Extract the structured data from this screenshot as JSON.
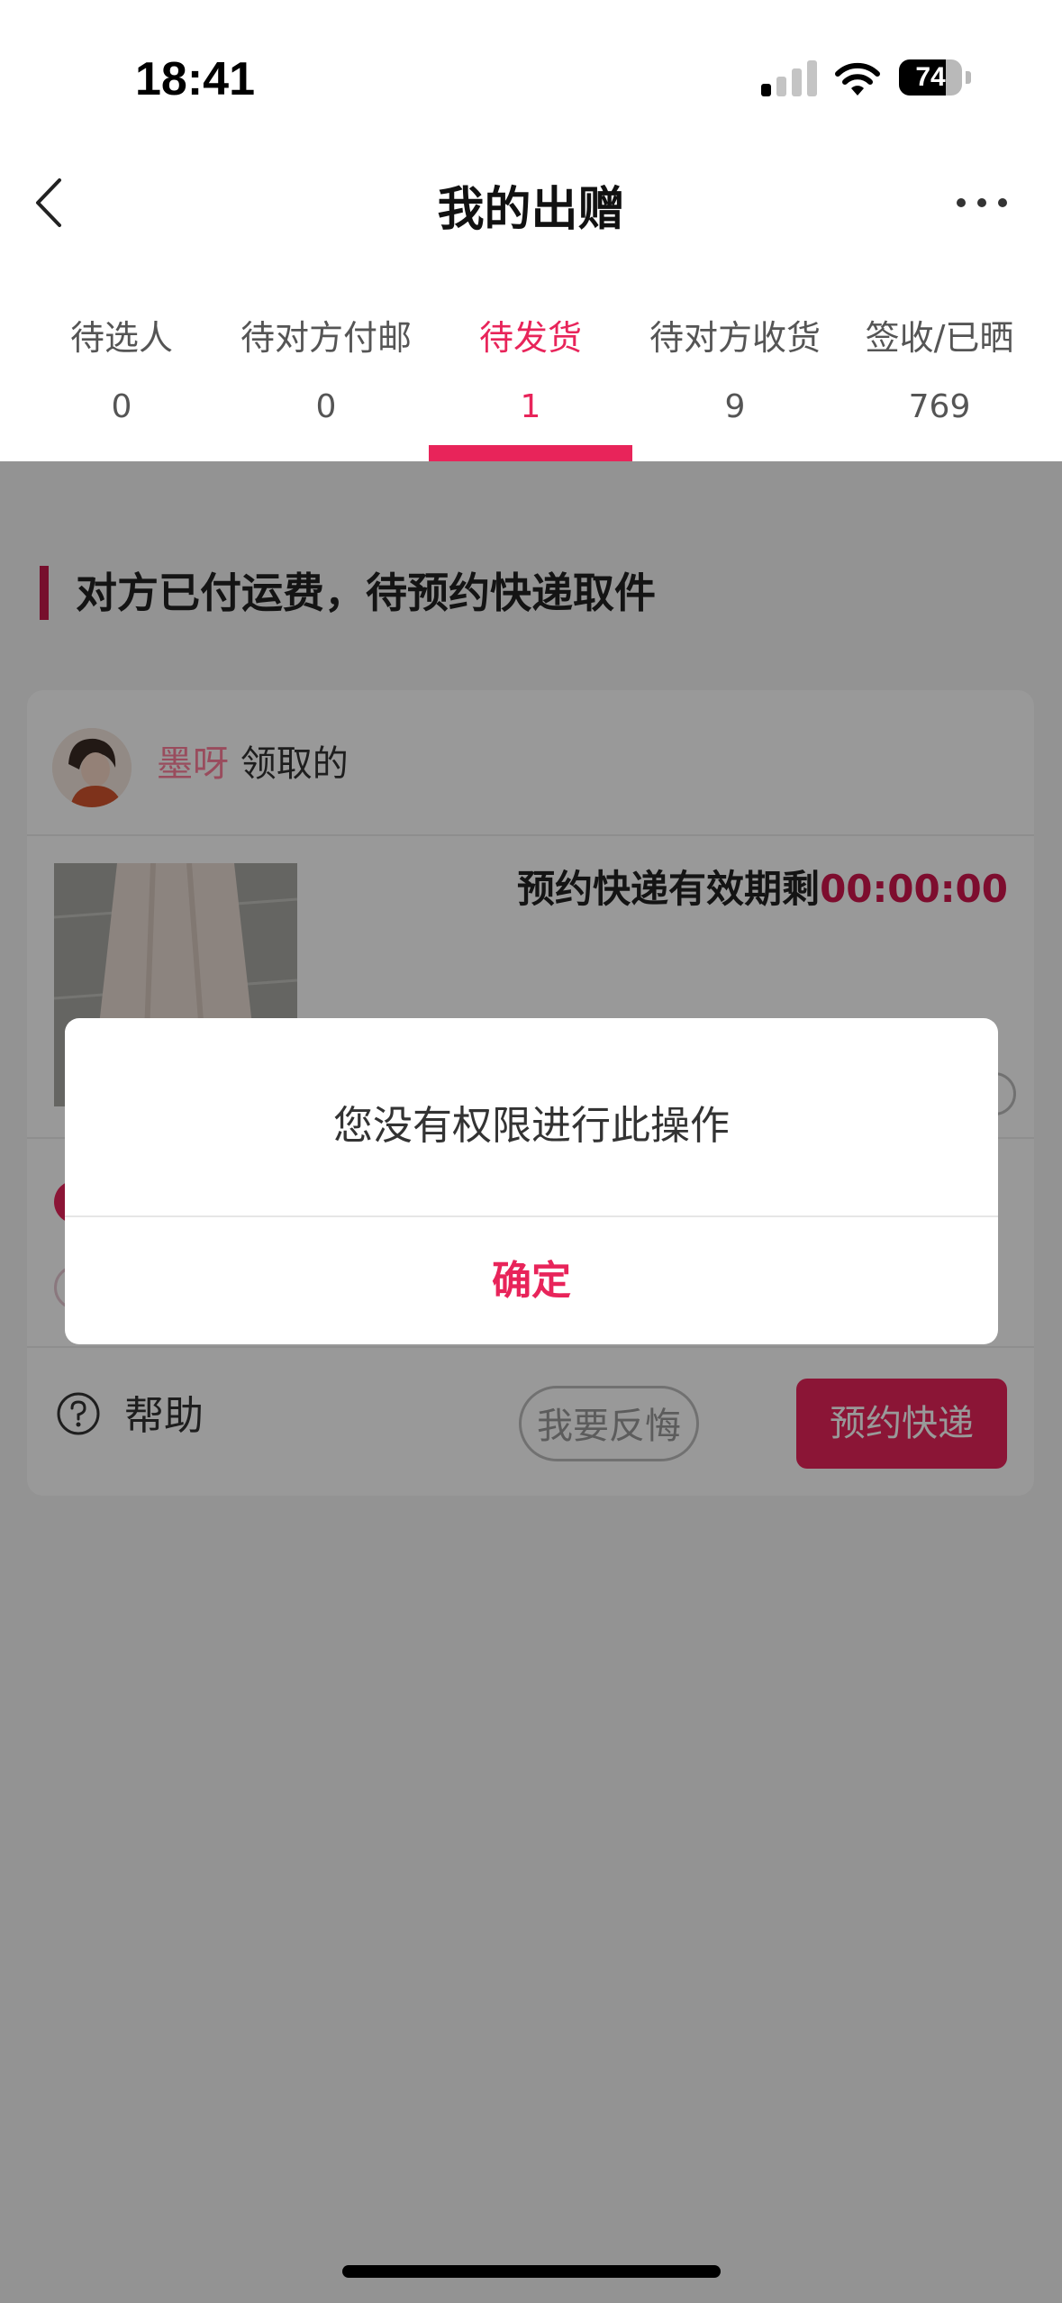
{
  "status_bar": {
    "time": "18:41",
    "battery": "74"
  },
  "nav": {
    "title": "我的出赠"
  },
  "tabs": [
    {
      "label": "待选人",
      "count": "0"
    },
    {
      "label": "待对方付邮",
      "count": "0"
    },
    {
      "label": "待发货",
      "count": "1",
      "active": true
    },
    {
      "label": "待对方收货",
      "count": "9"
    },
    {
      "label": "签收/已晒",
      "count": "769"
    }
  ],
  "section": {
    "title": "对方已付运费，待预约快递取件"
  },
  "order": {
    "user_name": "墨呀",
    "user_suffix": "领取的",
    "deadline_label": "预约快递有效期剩",
    "deadline_timer": "00:00:00"
  },
  "actions": {
    "help": "帮助",
    "regret": "我要反悔",
    "book": "预约快递"
  },
  "dialog": {
    "message": "您没有权限进行此操作",
    "confirm": "确定"
  },
  "colors": {
    "accent": "#e8245a",
    "timer": "#d0174d",
    "username": "#ff7f9b"
  }
}
